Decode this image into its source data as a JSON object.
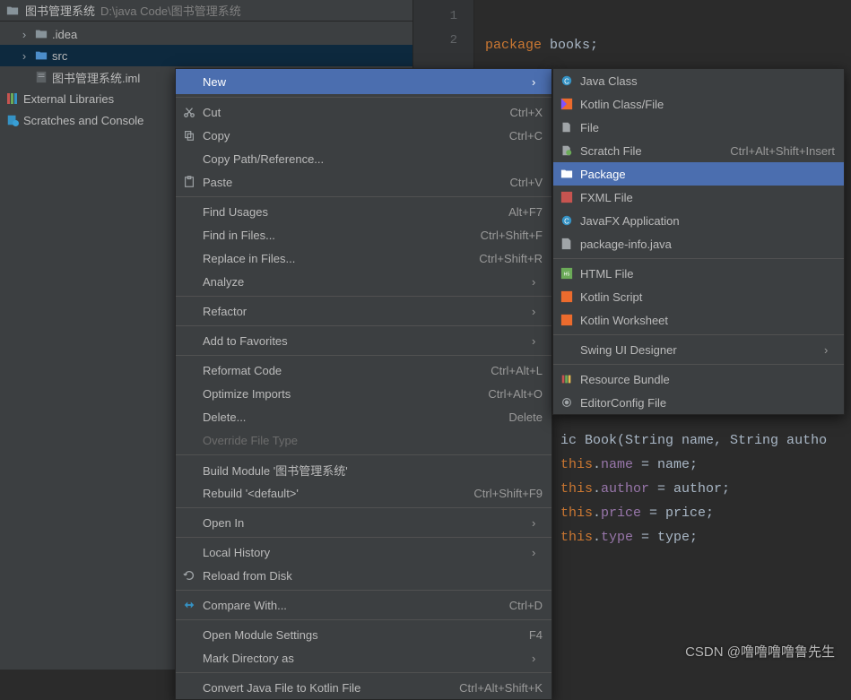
{
  "breadcrumb": {
    "project": "图书管理系统",
    "path": "D:\\java Code\\图书管理系统"
  },
  "tree": {
    "idea": ".idea",
    "src": "src",
    "iml": "图书管理系统.iml",
    "ext": "External Libraries",
    "scratches": "Scratches and Console"
  },
  "gutter": {
    "l1": "1",
    "l2": "2"
  },
  "code": {
    "line1_kw": "package",
    "line1_rest": " books;",
    "line17_pre": "ic ",
    "line17_kw": "Book",
    "line17_sig": "(String name, String autho",
    "line18_kw": "this",
    "line18_dot": ".",
    "line18_field": "name",
    "line18_rest": " = name;",
    "line19_kw": "this",
    "line19_dot": ".",
    "line19_field": "author",
    "line19_rest": " = author;",
    "line20_kw": "this",
    "line20_dot": ".",
    "line20_field": "price",
    "line20_rest": " = price;",
    "line21_kw": "this",
    "line21_dot": ".",
    "line21_field": "type",
    "line21_rest": " = type;"
  },
  "menu": {
    "new": "New",
    "cut": "Cut",
    "cut_sc": "Ctrl+X",
    "copy": "Copy",
    "copy_sc": "Ctrl+C",
    "copypath": "Copy Path/Reference...",
    "paste": "Paste",
    "paste_sc": "Ctrl+V",
    "findusages": "Find Usages",
    "findusages_sc": "Alt+F7",
    "findfiles": "Find in Files...",
    "findfiles_sc": "Ctrl+Shift+F",
    "replacefiles": "Replace in Files...",
    "replacefiles_sc": "Ctrl+Shift+R",
    "analyze": "Analyze",
    "refactor": "Refactor",
    "addfav": "Add to Favorites",
    "reformat": "Reformat Code",
    "reformat_sc": "Ctrl+Alt+L",
    "optimize": "Optimize Imports",
    "optimize_sc": "Ctrl+Alt+O",
    "delete": "Delete...",
    "delete_sc": "Delete",
    "override": "Override File Type",
    "buildmod": "Build Module '图书管理系统'",
    "rebuild": "Rebuild '<default>'",
    "rebuild_sc": "Ctrl+Shift+F9",
    "openin": "Open In",
    "localhist": "Local History",
    "reload": "Reload from Disk",
    "compare": "Compare With...",
    "compare_sc": "Ctrl+D",
    "modsettings": "Open Module Settings",
    "modsettings_sc": "F4",
    "markdir": "Mark Directory as",
    "convert": "Convert Java File to Kotlin File",
    "convert_sc": "Ctrl+Alt+Shift+K"
  },
  "submenu": {
    "javaclass": "Java Class",
    "kotlinclass": "Kotlin Class/File",
    "file": "File",
    "scratch": "Scratch File",
    "scratch_sc": "Ctrl+Alt+Shift+Insert",
    "package": "Package",
    "fxml": "FXML File",
    "javafx": "JavaFX Application",
    "pkginfo": "package-info.java",
    "html": "HTML File",
    "kscript": "Kotlin Script",
    "kworksheet": "Kotlin Worksheet",
    "swing": "Swing UI Designer",
    "resource": "Resource Bundle",
    "editorconfig": "EditorConfig File"
  },
  "watermark": "CSDN @噜噜噜噜鲁先生"
}
